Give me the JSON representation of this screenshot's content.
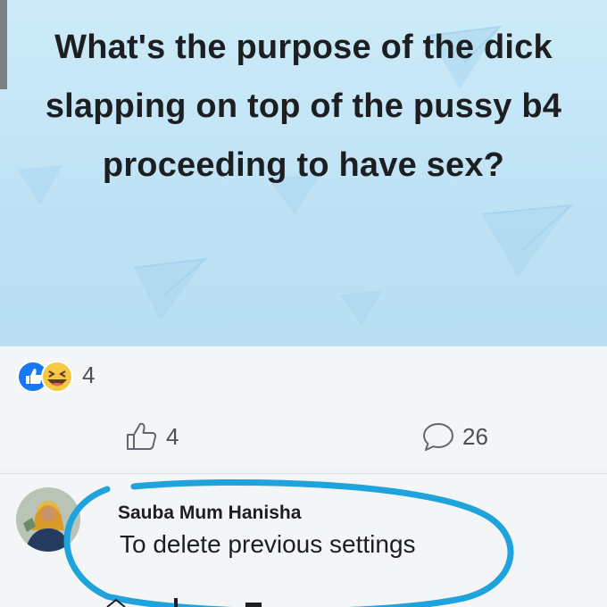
{
  "post": {
    "text": "What's the purpose of the dick slapping on top of the pussy b4 proceeding to have sex?",
    "background_color": "#c4e5f6"
  },
  "reactions": {
    "icons": [
      "like-icon",
      "haha-icon"
    ],
    "count": "4"
  },
  "actions": {
    "like_count": "4",
    "comment_count": "26"
  },
  "comment": {
    "author": "Sauba Mum Hanisha",
    "text": "To delete previous settings",
    "highlight_color": "#1fa3dc"
  },
  "colors": {
    "like_blue": "#1877f2",
    "haha_yellow": "#f7c844",
    "text_dark": "#1c1e21",
    "text_muted": "#4b4f56"
  }
}
